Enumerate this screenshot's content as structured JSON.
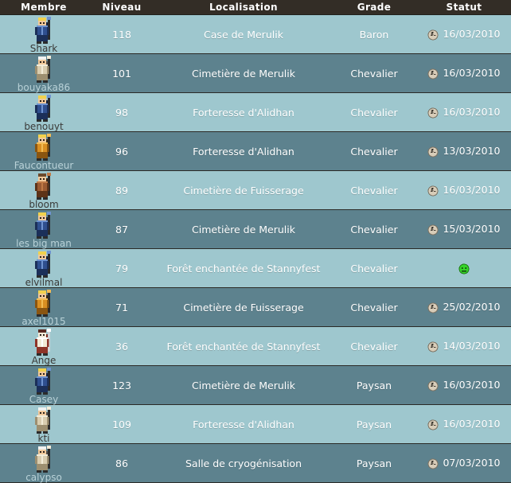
{
  "table": {
    "columns": [
      {
        "key": "membre",
        "label": "Membre"
      },
      {
        "key": "niveau",
        "label": "Niveau"
      },
      {
        "key": "local",
        "label": "Localisation"
      },
      {
        "key": "grade",
        "label": "Grade"
      },
      {
        "key": "statut",
        "label": "Statut"
      }
    ],
    "colors": {
      "header_bg": "#332d26",
      "header_text": "#ffffff",
      "row_light": "#9ec7ce",
      "row_dark": "#5d828e",
      "row_border": "#2a2a26",
      "cell_text": "#ffffff",
      "online_icon": "#35d42a",
      "away_icon": "#d8cdb9"
    },
    "rows": [
      {
        "name": "Shark",
        "level": "118",
        "location": "Case de Merulik",
        "grade": "Baron",
        "status_icon": "sleeping-face-icon",
        "status_date": "16/03/2010",
        "avatar": "knight-blue"
      },
      {
        "name": "bouyaka86",
        "level": "101",
        "location": "Cimetière de Merulik",
        "grade": "Chevalier",
        "status_icon": "sleeping-face-icon",
        "status_date": "16/03/2010",
        "avatar": "mage-white"
      },
      {
        "name": "benouyt",
        "level": "98",
        "location": "Forteresse d'Alidhan",
        "grade": "Chevalier",
        "status_icon": "sleeping-face-icon",
        "status_date": "16/03/2010",
        "avatar": "knight-blue"
      },
      {
        "name": "Faucontueur",
        "level": "96",
        "location": "Forteresse d'Alidhan",
        "grade": "Chevalier",
        "status_icon": "sleeping-face-icon",
        "status_date": "13/03/2010",
        "avatar": "archer-gold"
      },
      {
        "name": "bloom",
        "level": "89",
        "location": "Cimetière de Fuisserage",
        "grade": "Chevalier",
        "status_icon": "sleeping-face-icon",
        "status_date": "16/03/2010",
        "avatar": "monk-brown"
      },
      {
        "name": "les big man",
        "level": "87",
        "location": "Cimetière de Merulik",
        "grade": "Chevalier",
        "status_icon": "sleeping-face-icon",
        "status_date": "15/03/2010",
        "avatar": "knight-blue"
      },
      {
        "name": "elvilmal",
        "level": "79",
        "location": "Forêt enchantée de Stannyfest",
        "grade": "Chevalier",
        "status_icon": "online-smiley-icon",
        "status_date": "",
        "avatar": "knight-blue"
      },
      {
        "name": "axel1015",
        "level": "71",
        "location": "Cimetière de Fuisserage",
        "grade": "Chevalier",
        "status_icon": "sleeping-face-icon",
        "status_date": "25/02/2010",
        "avatar": "archer-gold"
      },
      {
        "name": "Ange",
        "level": "36",
        "location": "Forêt enchantée de Stannyfest",
        "grade": "Chevalier",
        "status_icon": "sleeping-face-icon",
        "status_date": "14/03/2010",
        "avatar": "cleric-red"
      },
      {
        "name": "Casey",
        "level": "123",
        "location": "Cimetière de Merulik",
        "grade": "Paysan",
        "status_icon": "sleeping-face-icon",
        "status_date": "16/03/2010",
        "avatar": "knight-blue"
      },
      {
        "name": "kti",
        "level": "109",
        "location": "Forteresse d'Alidhan",
        "grade": "Paysan",
        "status_icon": "sleeping-face-icon",
        "status_date": "16/03/2010",
        "avatar": "mage-white"
      },
      {
        "name": "calypso",
        "level": "86",
        "location": "Salle de cryogénisation",
        "grade": "Paysan",
        "status_icon": "sleeping-face-icon",
        "status_date": "07/03/2010",
        "avatar": "mage-white"
      }
    ]
  }
}
